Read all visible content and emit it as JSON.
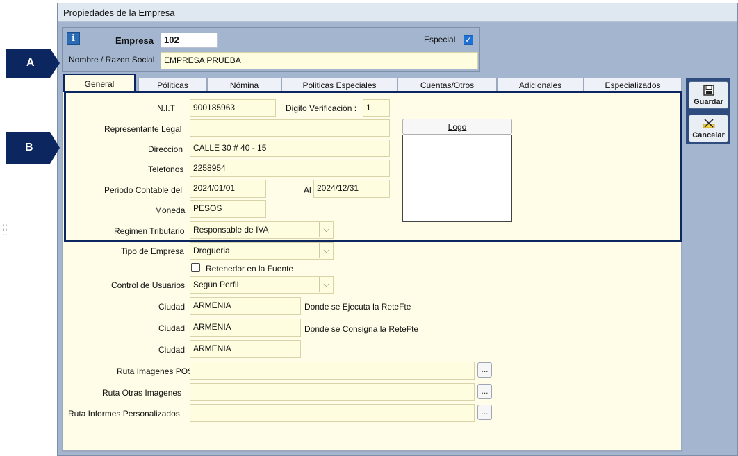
{
  "window": {
    "title": "Propiedades de la Empresa"
  },
  "header": {
    "empresa_label": "Empresa",
    "empresa_value": "102",
    "especial_label": "Especial",
    "especial_checked": true,
    "nombre_label": "Nombre / Razon Social",
    "nombre_value": "EMPRESA PRUEBA",
    "info_icon": "i"
  },
  "callouts": {
    "a": "A",
    "b": "B"
  },
  "tabs": [
    {
      "label": "General",
      "active": true
    },
    {
      "label": "Póliticas"
    },
    {
      "label": "Nómina"
    },
    {
      "label": "Politicas Especiales"
    },
    {
      "label": "Cuentas/Otros"
    },
    {
      "label": "Adicionales"
    },
    {
      "label": "Especializados"
    }
  ],
  "form": {
    "nit_label": "N.I.T",
    "nit_value": "900185963",
    "digito_label": "Digito Verificación :",
    "digito_value": "1",
    "representante_label": "Representante Legal",
    "representante_value": "",
    "direccion_label": "Direccion",
    "direccion_value": "CALLE 30 # 40 - 15",
    "telefonos_label": "Telefonos",
    "telefonos_value": "2258954",
    "periodo_label": "Periodo Contable del",
    "periodo_from": "2024/01/01",
    "al_label": "Al",
    "periodo_to": "2024/12/31",
    "moneda_label": "Moneda",
    "moneda_value": "PESOS",
    "regimen_label": "Regimen Tributario",
    "regimen_value": "Responsable de IVA",
    "tipo_label": "Tipo de Empresa",
    "tipo_value": "Drogueria",
    "retenedor_label": "Retenedor en la Fuente",
    "retenedor_checked": false,
    "control_label": "Control de Usuarios",
    "control_value": "Según Perfil",
    "ciudad_label": "Ciudad",
    "ciudad1_value": "ARMENIA",
    "ciudad1_note": "Donde se Ejecuta  la ReteFte",
    "ciudad2_value": "ARMENIA",
    "ciudad2_note": "Donde se Consigna la ReteFte",
    "ciudad3_value": "ARMENIA",
    "ruta_pos_label": "Ruta Imagenes POS",
    "ruta_pos_value": "",
    "ruta_otras_label": "Ruta Otras Imagenes",
    "ruta_otras_value": "",
    "ruta_informes_label": "Ruta Informes Personalizados",
    "ruta_informes_value": "",
    "browse_label": "...",
    "logo_label": "Logo"
  },
  "actions": {
    "guardar": "Guardar",
    "cancelar": "Cancelar"
  },
  "icons": [
    "info-icon",
    "checkbox-icon",
    "dropdown-arrow-icon",
    "save-icon",
    "cancel-icon",
    "drag-grip-icon"
  ],
  "colors": {
    "accent": "#0c2660",
    "window_bg": "#a4b6cf",
    "field_bg": "#fffde0",
    "checkbox": "#1e72d6"
  }
}
